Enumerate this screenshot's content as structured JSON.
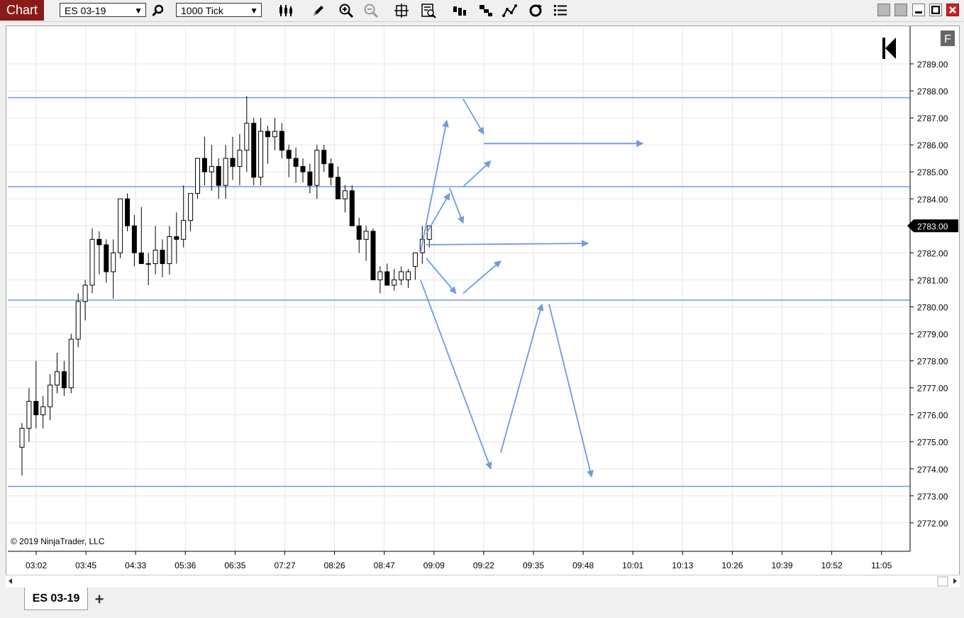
{
  "toolbar": {
    "title": "Chart",
    "instrument": "ES 03-19",
    "interval": "1000 Tick",
    "f_label": "F"
  },
  "tabs": [
    {
      "label": "ES 03-19"
    }
  ],
  "tab_add_label": "+",
  "copyright": "© 2019 NinjaTrader, LLC",
  "colors": {
    "title_bg": "#8b1a1a",
    "level_line": "#6f9be0",
    "arrow": "#6f9be0",
    "price_marker_bg": "#000000"
  },
  "chart_data": {
    "type": "candlestick",
    "title": "",
    "xlabel": "",
    "ylabel": "",
    "ylim": [
      2771.0,
      2790.0
    ],
    "y_ticks": [
      "2789.00",
      "2788.00",
      "2787.00",
      "2786.00",
      "2785.00",
      "2784.00",
      "2783.00",
      "2782.00",
      "2781.00",
      "2780.00",
      "2779.00",
      "2778.00",
      "2777.00",
      "2776.00",
      "2775.00",
      "2774.00",
      "2773.00",
      "2772.00"
    ],
    "x_ticks": [
      "03:02",
      "03:45",
      "04:33",
      "05:36",
      "06:35",
      "07:27",
      "08:26",
      "08:47",
      "09:09",
      "09:22",
      "09:35",
      "09:48",
      "10:01",
      "10:13",
      "10:26",
      "10:39",
      "10:52",
      "11:05"
    ],
    "last_price": "2783.00",
    "grid": true,
    "horizontal_levels": [
      2787.75,
      2784.45,
      2780.25,
      2773.35
    ],
    "candles": [
      {
        "o": 2774.8,
        "h": 2775.7,
        "l": 2773.75,
        "c": 2775.5
      },
      {
        "o": 2775.5,
        "h": 2777.0,
        "l": 2775.0,
        "c": 2776.5
      },
      {
        "o": 2776.5,
        "h": 2778.0,
        "l": 2775.5,
        "c": 2776.0
      },
      {
        "o": 2776.0,
        "h": 2776.7,
        "l": 2775.5,
        "c": 2776.3
      },
      {
        "o": 2776.3,
        "h": 2777.5,
        "l": 2775.8,
        "c": 2777.1
      },
      {
        "o": 2777.1,
        "h": 2778.3,
        "l": 2776.8,
        "c": 2777.6
      },
      {
        "o": 2777.6,
        "h": 2778.0,
        "l": 2776.7,
        "c": 2777.0
      },
      {
        "o": 2777.0,
        "h": 2779.0,
        "l": 2776.8,
        "c": 2778.8
      },
      {
        "o": 2778.8,
        "h": 2780.5,
        "l": 2778.5,
        "c": 2780.2
      },
      {
        "o": 2780.2,
        "h": 2781.0,
        "l": 2779.5,
        "c": 2780.8
      },
      {
        "o": 2780.8,
        "h": 2782.9,
        "l": 2780.5,
        "c": 2782.5
      },
      {
        "o": 2782.5,
        "h": 2782.8,
        "l": 2781.2,
        "c": 2782.3
      },
      {
        "o": 2782.3,
        "h": 2782.5,
        "l": 2780.9,
        "c": 2781.3
      },
      {
        "o": 2781.3,
        "h": 2782.5,
        "l": 2780.3,
        "c": 2782.0
      },
      {
        "o": 2782.0,
        "h": 2784.0,
        "l": 2781.8,
        "c": 2784.0
      },
      {
        "o": 2784.0,
        "h": 2784.2,
        "l": 2782.8,
        "c": 2783.0
      },
      {
        "o": 2783.0,
        "h": 2783.4,
        "l": 2781.5,
        "c": 2782.0
      },
      {
        "o": 2782.0,
        "h": 2783.7,
        "l": 2781.6,
        "c": 2781.6
      },
      {
        "o": 2781.6,
        "h": 2782.0,
        "l": 2780.8,
        "c": 2781.6
      },
      {
        "o": 2781.6,
        "h": 2783.0,
        "l": 2781.2,
        "c": 2782.1
      },
      {
        "o": 2782.1,
        "h": 2782.5,
        "l": 2781.1,
        "c": 2781.6
      },
      {
        "o": 2781.6,
        "h": 2783.0,
        "l": 2781.2,
        "c": 2782.6
      },
      {
        "o": 2782.6,
        "h": 2783.5,
        "l": 2781.6,
        "c": 2782.5
      },
      {
        "o": 2782.5,
        "h": 2784.5,
        "l": 2782.2,
        "c": 2783.2
      },
      {
        "o": 2783.2,
        "h": 2784.2,
        "l": 2782.8,
        "c": 2784.2
      },
      {
        "o": 2784.2,
        "h": 2785.5,
        "l": 2784.0,
        "c": 2785.5
      },
      {
        "o": 2785.5,
        "h": 2786.3,
        "l": 2784.5,
        "c": 2785.0
      },
      {
        "o": 2785.0,
        "h": 2786.0,
        "l": 2784.3,
        "c": 2785.2
      },
      {
        "o": 2785.2,
        "h": 2785.5,
        "l": 2784.0,
        "c": 2784.5
      },
      {
        "o": 2784.5,
        "h": 2786.0,
        "l": 2784.0,
        "c": 2785.5
      },
      {
        "o": 2785.5,
        "h": 2786.3,
        "l": 2784.7,
        "c": 2785.2
      },
      {
        "o": 2785.2,
        "h": 2786.4,
        "l": 2784.5,
        "c": 2785.8
      },
      {
        "o": 2785.8,
        "h": 2787.8,
        "l": 2785.0,
        "c": 2786.8
      },
      {
        "o": 2786.8,
        "h": 2787.0,
        "l": 2784.5,
        "c": 2784.8
      },
      {
        "o": 2784.8,
        "h": 2787.0,
        "l": 2784.5,
        "c": 2786.5
      },
      {
        "o": 2786.5,
        "h": 2786.7,
        "l": 2785.3,
        "c": 2786.3
      },
      {
        "o": 2786.3,
        "h": 2787.0,
        "l": 2785.8,
        "c": 2786.5
      },
      {
        "o": 2786.5,
        "h": 2786.8,
        "l": 2785.5,
        "c": 2785.8
      },
      {
        "o": 2785.8,
        "h": 2786.0,
        "l": 2784.8,
        "c": 2785.5
      },
      {
        "o": 2785.5,
        "h": 2785.9,
        "l": 2784.6,
        "c": 2785.2
      },
      {
        "o": 2785.2,
        "h": 2785.5,
        "l": 2784.6,
        "c": 2785.0
      },
      {
        "o": 2785.0,
        "h": 2785.3,
        "l": 2784.2,
        "c": 2784.5
      },
      {
        "o": 2784.5,
        "h": 2786.0,
        "l": 2784.0,
        "c": 2785.8
      },
      {
        "o": 2785.8,
        "h": 2786.0,
        "l": 2785.0,
        "c": 2785.3
      },
      {
        "o": 2785.3,
        "h": 2785.5,
        "l": 2784.5,
        "c": 2784.8
      },
      {
        "o": 2784.8,
        "h": 2785.2,
        "l": 2784.0,
        "c": 2784.0
      },
      {
        "o": 2784.0,
        "h": 2784.5,
        "l": 2783.5,
        "c": 2784.3
      },
      {
        "o": 2784.3,
        "h": 2784.5,
        "l": 2783.0,
        "c": 2783.0
      },
      {
        "o": 2783.0,
        "h": 2783.3,
        "l": 2782.0,
        "c": 2782.5
      },
      {
        "o": 2782.5,
        "h": 2783.0,
        "l": 2781.7,
        "c": 2782.8
      },
      {
        "o": 2782.8,
        "h": 2782.9,
        "l": 2781.0,
        "c": 2781.0
      },
      {
        "o": 2781.0,
        "h": 2781.5,
        "l": 2780.5,
        "c": 2781.3
      },
      {
        "o": 2781.3,
        "h": 2781.6,
        "l": 2780.8,
        "c": 2780.8
      },
      {
        "o": 2780.8,
        "h": 2781.4,
        "l": 2780.6,
        "c": 2781.0
      },
      {
        "o": 2781.0,
        "h": 2781.5,
        "l": 2780.8,
        "c": 2781.3
      },
      {
        "o": 2781.0,
        "h": 2781.4,
        "l": 2780.7,
        "c": 2781.3
      },
      {
        "o": 2781.5,
        "h": 2782.0,
        "l": 2781.0,
        "c": 2782.0
      },
      {
        "o": 2782.0,
        "h": 2783.0,
        "l": 2781.6,
        "c": 2782.5
      },
      {
        "o": 2782.5,
        "h": 2783.0,
        "l": 2782.2,
        "c": 2783.0
      }
    ],
    "annotation_arrows": [
      {
        "from": [
          2782.0,
          "09:09a"
        ],
        "to": [
          2786.9,
          "09:09c"
        ]
      },
      {
        "from": [
          2787.7,
          "09:22a"
        ],
        "to": [
          2786.4,
          "09:22b"
        ]
      },
      {
        "from": [
          2786.05,
          "09:22b"
        ],
        "to": [
          2786.05,
          "10:01b"
        ]
      },
      {
        "from": [
          2784.45,
          "09:22a"
        ],
        "to": [
          2785.4,
          "09:22c"
        ]
      },
      {
        "from": [
          2784.4,
          "09:09d"
        ],
        "to": [
          2783.1,
          "09:22a"
        ]
      },
      {
        "from": [
          2782.7,
          "09:09b"
        ],
        "to": [
          2784.2,
          "09:09d"
        ]
      },
      {
        "from": [
          2782.3,
          "09:09b"
        ],
        "to": [
          2782.35,
          "09:48a"
        ]
      },
      {
        "from": [
          2781.8,
          "09:09b"
        ],
        "to": [
          2780.5,
          "09:09e"
        ]
      },
      {
        "from": [
          2780.5,
          "09:22a"
        ],
        "to": [
          2781.7,
          "09:22d"
        ]
      },
      {
        "from": [
          2781.0,
          "09:09a"
        ],
        "to": [
          2774.0,
          "09:22c"
        ]
      },
      {
        "from": [
          2774.6,
          "09:22d"
        ],
        "to": [
          2780.1,
          "09:35b"
        ]
      },
      {
        "from": [
          2780.1,
          "09:35c"
        ],
        "to": [
          2773.7,
          "09:48b"
        ]
      }
    ]
  }
}
